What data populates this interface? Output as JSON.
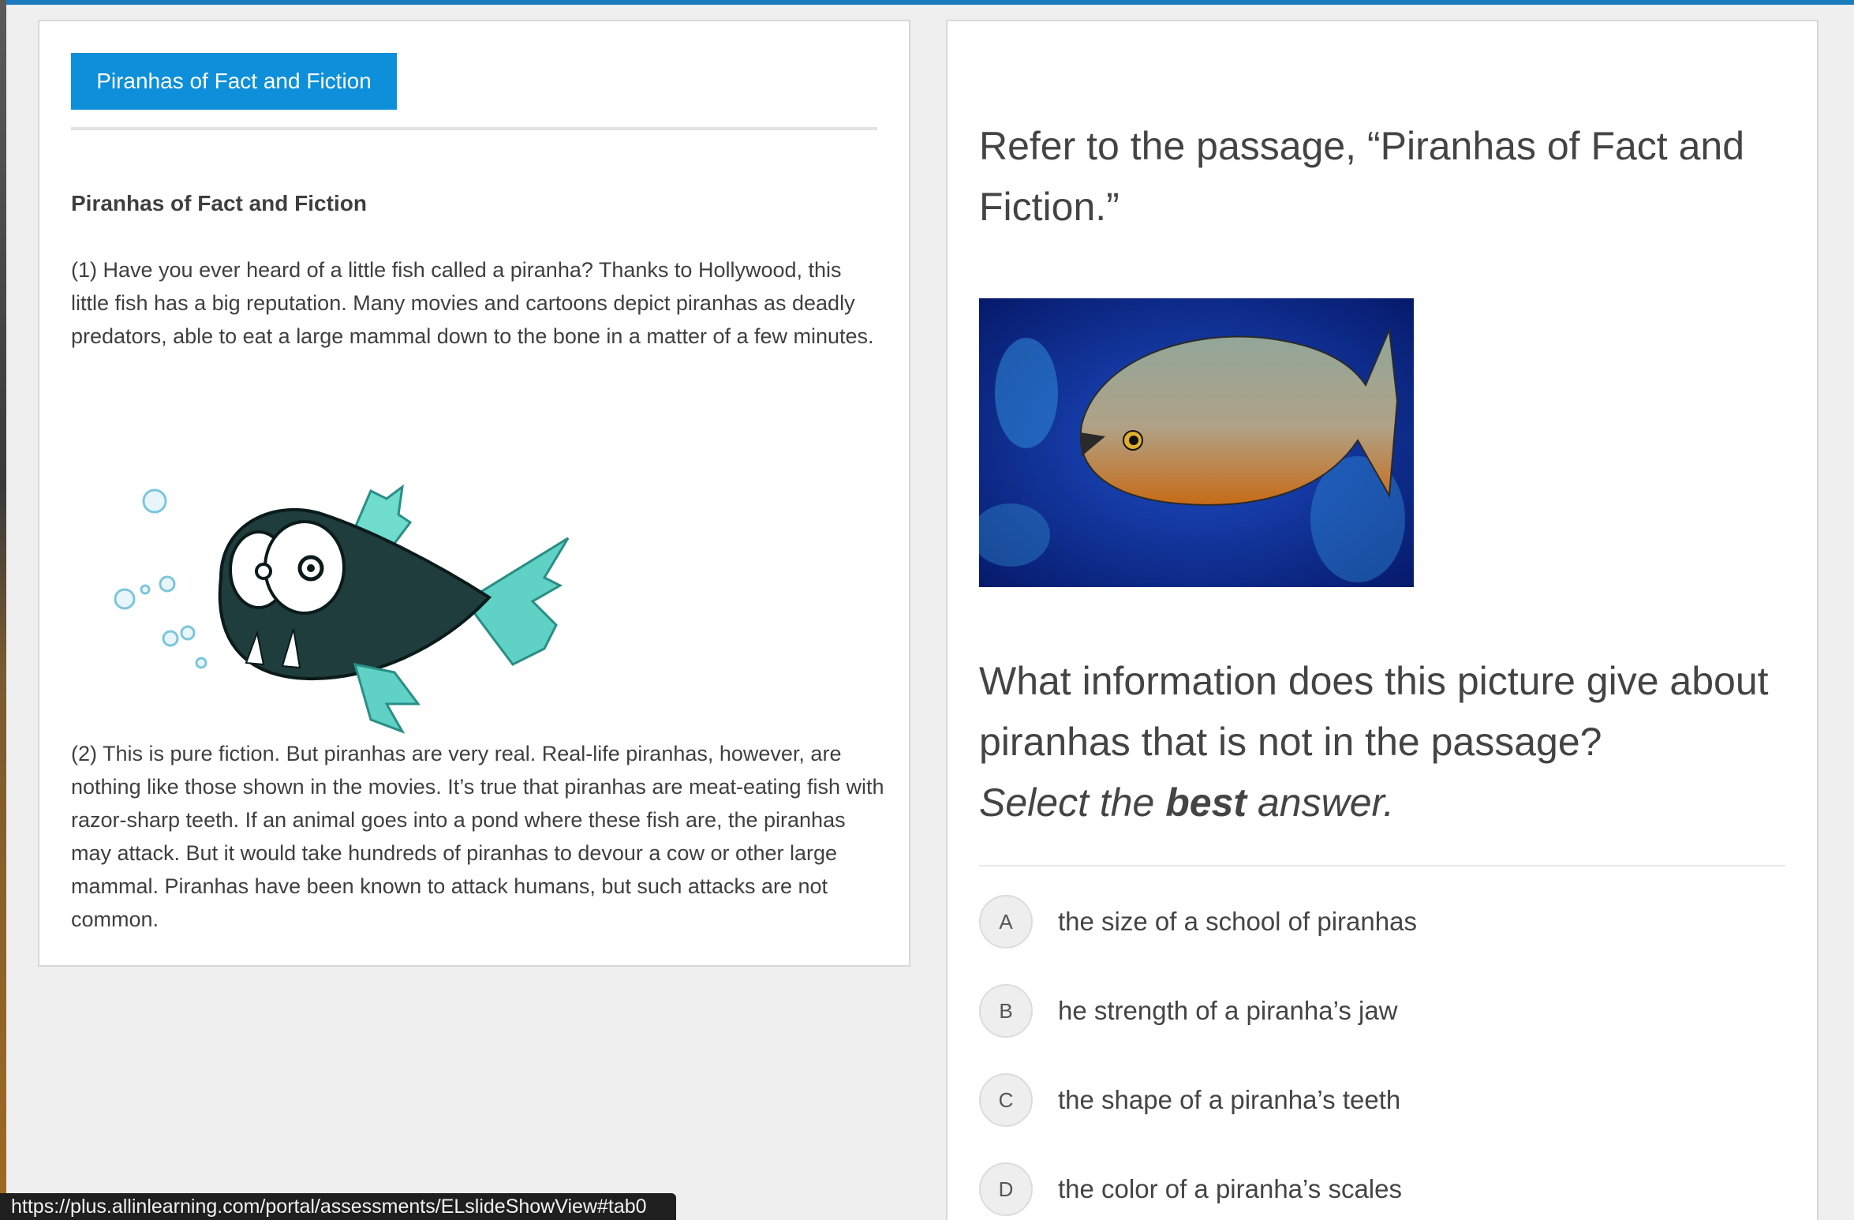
{
  "passage_tab": {
    "label": "Piranhas of Fact and Fiction"
  },
  "passage": {
    "title": "Piranhas of Fact and Fiction",
    "paragraph1": "(1) Have you ever heard of a little fish called a piranha? Thanks to Hollywood, this little fish has a big reputation. Many movies and cartoons depict piranhas as deadly predators, able to eat a large mammal down to the bone in a matter of a few minutes.",
    "paragraph2": "(2) This is pure fiction. But piranhas are very real. Real-life piranhas, however, are nothing like those shown in the movies. It’s true that piranhas are meat-eating fish with razor-sharp teeth. If an animal goes into a pond where these fish are, the piranhas may attack. But it would take hundreds of piranhas to devour a cow or other large mammal. Piranhas have been known to attack humans, but such attacks are not common."
  },
  "question": {
    "prompt": "Refer to the passage, “Piranhas of Fact and Fiction.”",
    "stem": "What information does this picture give about piranhas that is not in the passage?",
    "instruction_pre": "Select the ",
    "instruction_bold": "best",
    "instruction_post": " answer.",
    "choices": [
      {
        "letter": "A",
        "text": "the size of a school of piranhas"
      },
      {
        "letter": "B",
        "text": "he strength of a piranha’s jaw"
      },
      {
        "letter": "C",
        "text": "the shape of a piranha’s teeth"
      },
      {
        "letter": "D",
        "text": "the color of a piranha’s scales"
      }
    ]
  },
  "status_bar": {
    "url": "https://plus.allinlearning.com/portal/assessments/ELslideShowView#tab0"
  },
  "colors": {
    "accent": "#0d8fd9",
    "top_bar": "#1a7bbf"
  }
}
